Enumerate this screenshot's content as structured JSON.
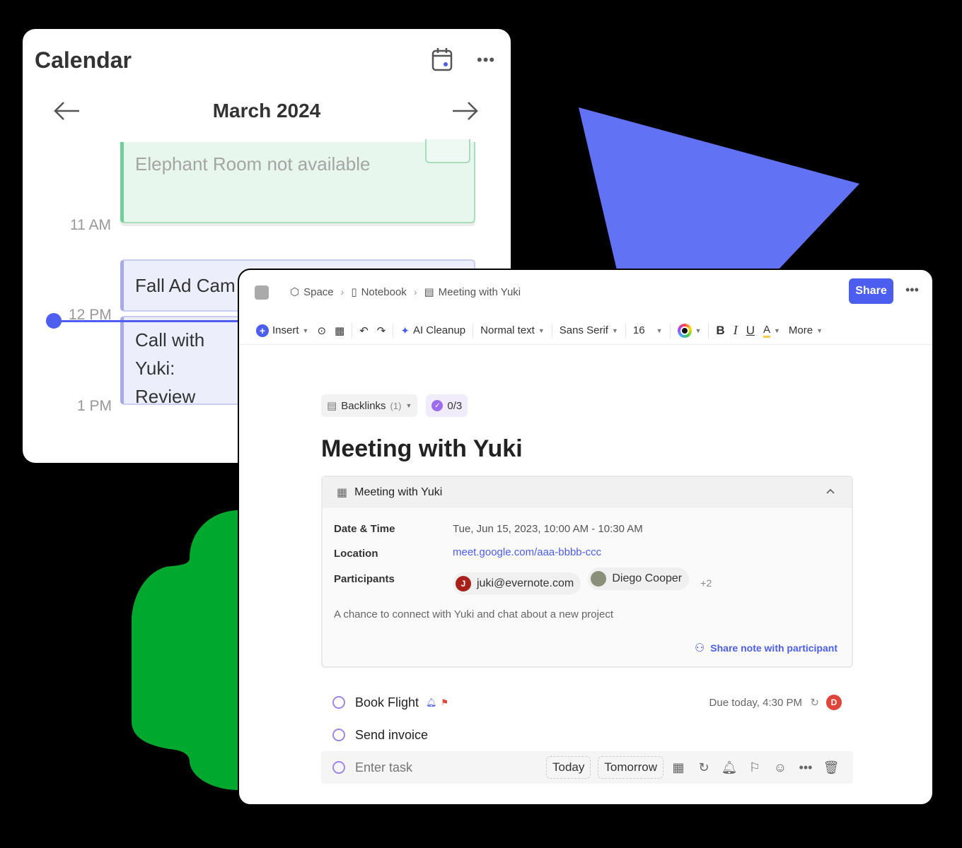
{
  "calendar": {
    "title": "Calendar",
    "month": "March 2024",
    "times": [
      "11 AM",
      "12 PM",
      "1 PM"
    ],
    "events": [
      "Elephant Room not available",
      "Fall Ad Cam",
      "Call with Yuki: Review"
    ]
  },
  "note": {
    "breadcrumbs": [
      "Space",
      "Notebook",
      "Meeting with Yuki"
    ],
    "share_label": "Share",
    "toolbar": {
      "insert": "Insert",
      "ai_cleanup": "AI Cleanup",
      "text_style": "Normal text",
      "font": "Sans Serif",
      "size": "16",
      "more": "More"
    },
    "backlinks_label": "Backlinks",
    "backlinks_count": "(1)",
    "tasks_progress": "0/3",
    "title": "Meeting with Yuki",
    "meeting": {
      "header": "Meeting with Yuki",
      "date_label": "Date & Time",
      "date_value": "Tue, Jun 15, 2023, 10:00 AM - 10:30 AM",
      "location_label": "Location",
      "location_value": "meet.google.com/aaa-bbbb-ccc",
      "participants_label": "Participants",
      "participants": [
        {
          "initial": "J",
          "name": "juki@evernote.com",
          "color": "#a8201a"
        },
        {
          "initial": "",
          "name": "Diego Cooper",
          "color": "#8a8f7a"
        }
      ],
      "more_participants": "+2",
      "description": "A chance to connect with Yuki and chat about a new project",
      "share_participant": "Share note with participant"
    },
    "tasks": [
      {
        "label": "Book Flight",
        "due": "Due today, 4:30 PM",
        "assignee": "D"
      },
      {
        "label": "Send invoice"
      }
    ],
    "task_entry": {
      "placeholder": "Enter task",
      "today": "Today",
      "tomorrow": "Tomorrow"
    }
  },
  "colors": {
    "accent": "#4b5ef0",
    "shape_blue": "#6272f5",
    "shape_green": "#00a82d"
  }
}
